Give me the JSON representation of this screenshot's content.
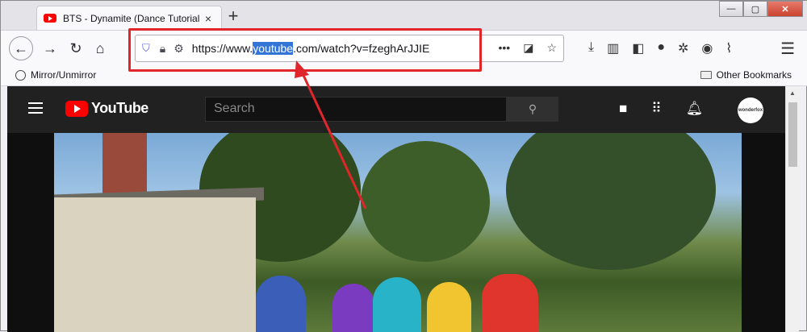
{
  "tab": {
    "title": "BTS - Dynamite (Dance Tutorial",
    "close": "×"
  },
  "new_tab": "+",
  "window_buttons": {
    "minimize": "—",
    "maximize": "▢",
    "close": "✕"
  },
  "nav": {
    "back": "←",
    "forward": "→",
    "reload": "↻",
    "home": "⌂"
  },
  "url": {
    "prefix": "https://www.",
    "highlight": "youtube",
    "suffix": ".com/watch?v=fzeghArJJIE"
  },
  "url_right_icons": [
    "•••",
    "pocket-icon",
    "star-icon"
  ],
  "toolbar_icons": [
    "download-icon",
    "library-icon",
    "sidebar-icon",
    "extension-icon",
    "settings-icon",
    "account-icon",
    "extension2-icon"
  ],
  "bookmarks": {
    "left": "Mirror/Unmirror",
    "right": "Other Bookmarks"
  },
  "youtube": {
    "logo": "YouTube",
    "search_placeholder": "Search",
    "avatar": "wonderfox"
  },
  "colors": {
    "highlight": "#3375d6",
    "annotation": "#e0252b",
    "yt_red": "#ff0000"
  }
}
